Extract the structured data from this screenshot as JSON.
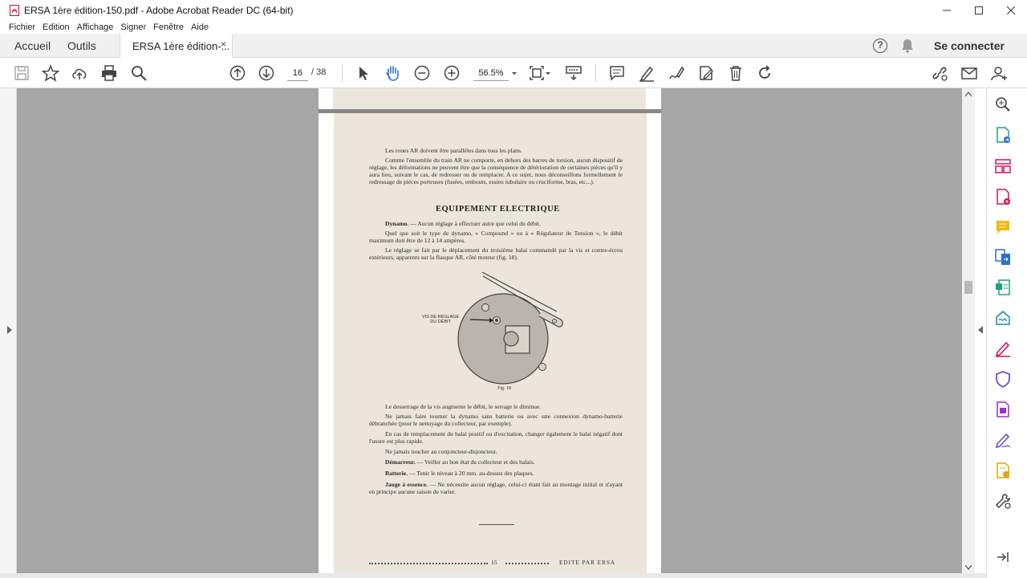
{
  "window": {
    "title": "ERSA 1ère édition-150.pdf - Adobe Acrobat Reader DC (64-bit)",
    "controls": {
      "minimize": "—",
      "maximize": "☐",
      "close": "✕"
    }
  },
  "menu": [
    "Fichier",
    "Edition",
    "Affichage",
    "Signer",
    "Fenêtre",
    "Aide"
  ],
  "tabs": {
    "home": "Accueil",
    "tools": "Outils",
    "document": "ERSA 1ère édition-...",
    "close": "×",
    "help": "?",
    "sign_in": "Se connecter"
  },
  "toolbar": {
    "current_page": "16",
    "total_pages": "/ 38",
    "zoom": "56.5%"
  },
  "document": {
    "paragraphs_top": [
      "Les roues AR doivent être parallèles dans tous les plans.",
      "Comme l'ensemble du train AR ne comporte, en dehors des barres de torsion, aucun dispositif de réglage, les déformations ne peuvent être que la conséquence de détérioration de certaines pièces qu'il y aura lieu, suivant le cas, de redresser ou de remplacer. A ce sujet, nous déconseillons formellement le redressage de pièces porteuses (fusées, embouts, essieu tubulaire ou cruciforme, bras, etc...)."
    ],
    "section_title": "EQUIPEMENT ELECTRIQUE",
    "dynamo_label": "Dynamo.",
    "dynamo_text": " — Aucun réglage à effectuer autre que celui du débit.",
    "para_compound": "Quel que soit le type de dynamo, « Compound » ou à « Régulateur de Tension », le débit maximum doit être de 12 à 14 ampères.",
    "para_reglage": "Le réglage se fait par le déplacement du troisième balai commandé par la vis et contre-écrou extérieurs, apparents sur la flasque AR, côté moteur (fig. 18).",
    "figure_label_1": "VIS DE RÉGLAGE",
    "figure_label_2": "DU DÉBIT",
    "figure_caption": "Fig. 18",
    "para_desserrage": "Le desserrage de la vis augmente le débit, le serrage le diminue.",
    "para_jamais": "Ne jamais faire tourner la dynamo sans batterie ou avec une connexion dynamo-batterie débranchée (pour le nettoyage du collecteur, par exemple).",
    "para_remplacement": "En cas de remplacement du balai positif ou d'excitation, changer également le balai négatif dont l'usure est plus rapide.",
    "para_conjoncteur": "Ne jamais toucher au conjoncteur-disjoncteur.",
    "demarreur_label": "Démarreur.",
    "demarreur_text": " — Veiller au bon état du collecteur et des balais.",
    "batterie_label": "Batterie.",
    "batterie_text": " — Tenir le niveau à 20 mm. au-dessus des plaques.",
    "jauge_label": "Jauge à essence.",
    "jauge_text": " — Ne nécessite aucun réglage, celui-ci étant fait au montage initial et n'ayant en principe aucune raison de varier.",
    "footer_page": "15",
    "footer_publisher": "EDITE PAR ERSA"
  },
  "colors": {
    "viewport_bg": "#a6a6a6",
    "paper": "#ece5db",
    "accent_red": "#d4145a",
    "accent_blue": "#2d6fd1"
  }
}
